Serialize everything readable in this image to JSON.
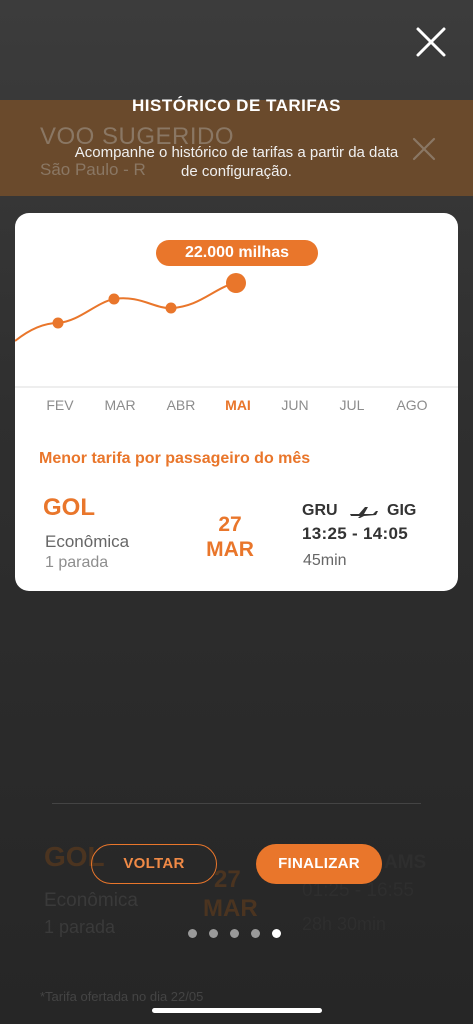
{
  "background": {
    "banner_title": "VOO SUGERIDO",
    "banner_subtitle": "São Paulo - R",
    "flight": {
      "airline_logo": "GOL",
      "cabin": "Econômica",
      "stops": "1 parada",
      "day": "27",
      "month": "MAR",
      "route_dest": "AMS",
      "times": "01:25  -  16:55",
      "duration": "28h 30min"
    },
    "footnote": "*Tarifa ofertada no dia 22/05"
  },
  "overlay": {
    "close_icon": "close-icon",
    "title": "HISTÓRICO DE TARIFAS",
    "subtitle": "Acompanhe o histórico de tarifas a partir da data de configuração."
  },
  "chart_data": {
    "type": "line",
    "categories": [
      "FEV",
      "MAR",
      "ABR",
      "MAI",
      "JUN",
      "JUL",
      "AGO"
    ],
    "highlighted": "MAI",
    "highlight_label": "22.000 milhas",
    "series": [
      {
        "values": [
          null,
          null,
          null,
          22000,
          null,
          null,
          null
        ]
      }
    ],
    "shape_note": "curve rises from FEV to MAI with a dip at ABR; only MAI value is labeled",
    "accent_color": "#e9762b"
  },
  "card": {
    "lowest_fare_label": "Menor tarifa por passageiro do mês",
    "flight": {
      "airline_logo": "GOL",
      "cabin": "Econômica",
      "stops": "1 parada",
      "day": "27",
      "month": "MAR",
      "origin": "GRU",
      "destination": "GIG",
      "plane_icon": "plane-icon",
      "times": "13:25  -  14:05",
      "duration": "45min"
    }
  },
  "buttons": {
    "back": "VOLTAR",
    "finish": "FINALIZAR"
  },
  "pager": {
    "count": 5,
    "active_index": 4
  },
  "colors": {
    "accent": "#e9762b",
    "card_bg": "#ffffff",
    "overlay_bg": "#2b2b2b"
  }
}
